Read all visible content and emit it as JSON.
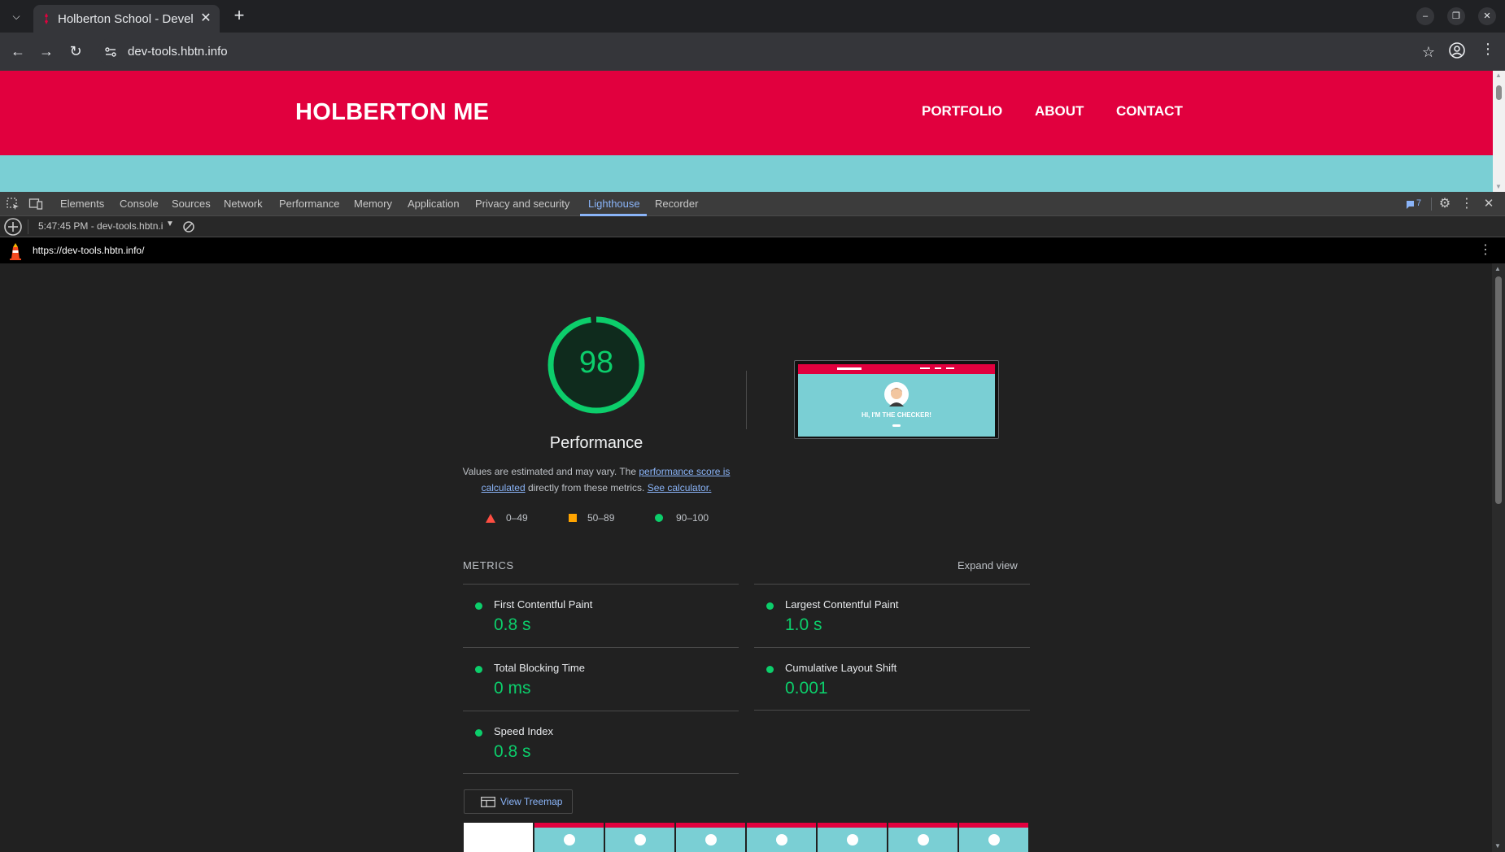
{
  "browser": {
    "tab_title": "Holberton School - Devel",
    "url": "dev-tools.hbtn.info"
  },
  "site": {
    "logo": "HOLBERTON ME",
    "nav": [
      "PORTFOLIO",
      "ABOUT",
      "CONTACT"
    ],
    "header_color": "#e1003e",
    "hero_color": "#7acfd4"
  },
  "devtools": {
    "tabs": [
      "Elements",
      "Console",
      "Sources",
      "Network",
      "Performance",
      "Memory",
      "Application",
      "Privacy and security",
      "Lighthouse",
      "Recorder"
    ],
    "active_tab": "Lighthouse",
    "issues_count": "7",
    "report_select": "5:47:45 PM - dev-tools.hbtn.i",
    "report_url": "https://dev-tools.hbtn.info/"
  },
  "report": {
    "score": "98",
    "score_fraction": 0.98,
    "score_color": "#0cce6b",
    "category_title": "Performance",
    "description_before": "Values are estimated and may vary. The ",
    "description_link1": "performance score is calculated",
    "description_middle": " directly from these metrics. ",
    "description_link2": "See calculator.",
    "screenshot_heading": "HI, I'M THE CHECKER!",
    "legend": [
      {
        "label": "0–49",
        "shape": "triangle",
        "color": "#ff4e42"
      },
      {
        "label": "50–89",
        "shape": "square",
        "color": "#ffa400"
      },
      {
        "label": "90–100",
        "shape": "circle",
        "color": "#0cce6b"
      }
    ],
    "metrics_label": "METRICS",
    "expand_view": "Expand view",
    "metrics": [
      {
        "name": "First Contentful Paint",
        "value": "0.8 s"
      },
      {
        "name": "Largest Contentful Paint",
        "value": "1.0 s"
      },
      {
        "name": "Total Blocking Time",
        "value": "0 ms"
      },
      {
        "name": "Cumulative Layout Shift",
        "value": "0.001"
      },
      {
        "name": "Speed Index",
        "value": "0.8 s"
      }
    ],
    "treemap_label": "View Treemap"
  }
}
